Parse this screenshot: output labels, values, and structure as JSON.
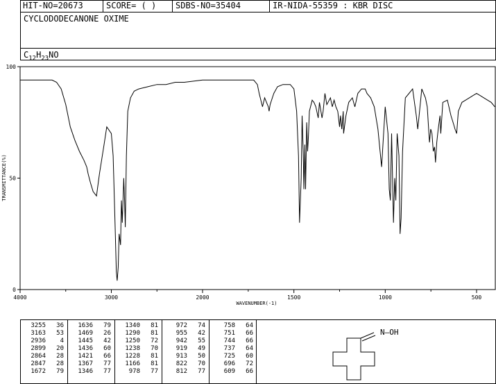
{
  "header": {
    "hit_no": "HIT-NO=20673",
    "score": "SCORE=  (  )",
    "sdbs_no": "SDBS-NO=35404",
    "ir_info": "IR-NIDA-55359 : KBR DISC"
  },
  "compound_name": "CYCLODODECANONE OXIME",
  "formula": {
    "c": "C",
    "c_sub": "12",
    "h": "H",
    "h_sub": "23",
    "rest": "NO"
  },
  "chart_data": {
    "type": "line",
    "xlabel": "WAVENUMBER(-1)",
    "ylabel": "TRANSMITTANCE(%)",
    "xlim": [
      4000,
      400
    ],
    "ylim": [
      0,
      100
    ],
    "x_ticks": [
      "4000",
      "3000",
      "2000",
      "1500",
      "1000",
      "500"
    ],
    "x_tick_values": [
      4000,
      3000,
      2000,
      1500,
      1000,
      500
    ],
    "y_ticks": [
      "100",
      "50",
      "0"
    ],
    "y_tick_values": [
      100,
      50,
      0
    ],
    "series": [
      {
        "x": [
          4000,
          3900,
          3800,
          3700,
          3650,
          3600,
          3550,
          3500,
          3450,
          3400,
          3350,
          3300,
          3270,
          3255,
          3230,
          3200,
          3163,
          3130,
          3080,
          3050,
          3000,
          2980,
          2960,
          2945,
          2936,
          2925,
          2915,
          2899,
          2890,
          2880,
          2864,
          2855,
          2847,
          2835,
          2820,
          2790,
          2750,
          2700,
          2600,
          2500,
          2400,
          2300,
          2200,
          2000,
          1900,
          1800,
          1720,
          1700,
          1690,
          1672,
          1660,
          1650,
          1640,
          1636,
          1630,
          1610,
          1590,
          1560,
          1520,
          1500,
          1485,
          1475,
          1469,
          1460,
          1455,
          1449,
          1445,
          1440,
          1436,
          1430,
          1425,
          1421,
          1415,
          1400,
          1390,
          1380,
          1367,
          1360,
          1346,
          1340,
          1330,
          1320,
          1300,
          1290,
          1280,
          1270,
          1260,
          1250,
          1245,
          1238,
          1230,
          1228,
          1215,
          1200,
          1180,
          1166,
          1150,
          1130,
          1110,
          1100,
          1080,
          1060,
          1040,
          1020,
          1000,
          985,
          978,
          972,
          965,
          955,
          948,
          942,
          935,
          925,
          919,
          913,
          905,
          890,
          870,
          850,
          830,
          822,
          812,
          800,
          790,
          780,
          770,
          758,
          751,
          744,
          737,
          730,
          725,
          718,
          710,
          700,
          696,
          685,
          660,
          640,
          625,
          618,
          609,
          600,
          580,
          560,
          540,
          520,
          500,
          480,
          460,
          440,
          420,
          400
        ],
        "y": [
          94,
          94,
          94,
          94,
          94,
          93,
          90,
          83,
          73,
          67,
          62,
          58,
          55,
          52,
          48,
          44,
          42,
          52,
          65,
          73,
          70,
          60,
          30,
          8,
          4,
          10,
          25,
          20,
          40,
          30,
          50,
          40,
          28,
          60,
          80,
          86,
          89,
          90,
          91,
          92,
          92,
          93,
          93,
          94,
          94,
          94,
          94,
          92,
          88,
          82,
          86,
          84,
          82,
          80,
          83,
          88,
          91,
          92,
          92,
          90,
          80,
          60,
          30,
          50,
          78,
          62,
          45,
          65,
          45,
          75,
          62,
          68,
          80,
          85,
          84,
          82,
          77,
          84,
          77,
          80,
          88,
          83,
          86,
          82,
          85,
          82,
          80,
          73,
          78,
          72,
          80,
          70,
          78,
          84,
          86,
          82,
          88,
          90,
          90,
          88,
          86,
          82,
          72,
          55,
          82,
          70,
          45,
          40,
          70,
          30,
          50,
          40,
          70,
          60,
          25,
          32,
          62,
          86,
          88,
          90,
          78,
          72,
          80,
          90,
          88,
          86,
          82,
          66,
          72,
          70,
          62,
          64,
          57,
          66,
          72,
          78,
          70,
          84,
          85,
          78,
          74,
          72,
          70,
          80,
          84,
          85,
          86,
          87,
          88,
          87,
          86,
          85,
          84,
          82
        ]
      }
    ]
  },
  "peaks": [
    [
      "3255",
      "36"
    ],
    [
      "3163",
      "53"
    ],
    [
      "2936",
      "4"
    ],
    [
      "2899",
      "20"
    ],
    [
      "2864",
      "28"
    ],
    [
      "2847",
      "28"
    ],
    [
      "1672",
      "79"
    ],
    [
      "1636",
      "79"
    ],
    [
      "1469",
      "26"
    ],
    [
      "1445",
      "42"
    ],
    [
      "1436",
      "60"
    ],
    [
      "1421",
      "66"
    ],
    [
      "1367",
      "77"
    ],
    [
      "1346",
      "77"
    ],
    [
      "1340",
      "81"
    ],
    [
      "1290",
      "81"
    ],
    [
      "1250",
      "72"
    ],
    [
      "1238",
      "70"
    ],
    [
      "1228",
      "81"
    ],
    [
      "1166",
      "81"
    ],
    [
      "978",
      "77"
    ],
    [
      "972",
      "74"
    ],
    [
      "955",
      "42"
    ],
    [
      "942",
      "55"
    ],
    [
      "919",
      "49"
    ],
    [
      "913",
      "50"
    ],
    [
      "822",
      "70"
    ],
    [
      "812",
      "77"
    ],
    [
      "758",
      "64"
    ],
    [
      "751",
      "66"
    ],
    [
      "744",
      "66"
    ],
    [
      "737",
      "64"
    ],
    [
      "725",
      "60"
    ],
    [
      "696",
      "72"
    ],
    [
      "609",
      "66"
    ]
  ],
  "structure_label": "N—OH"
}
